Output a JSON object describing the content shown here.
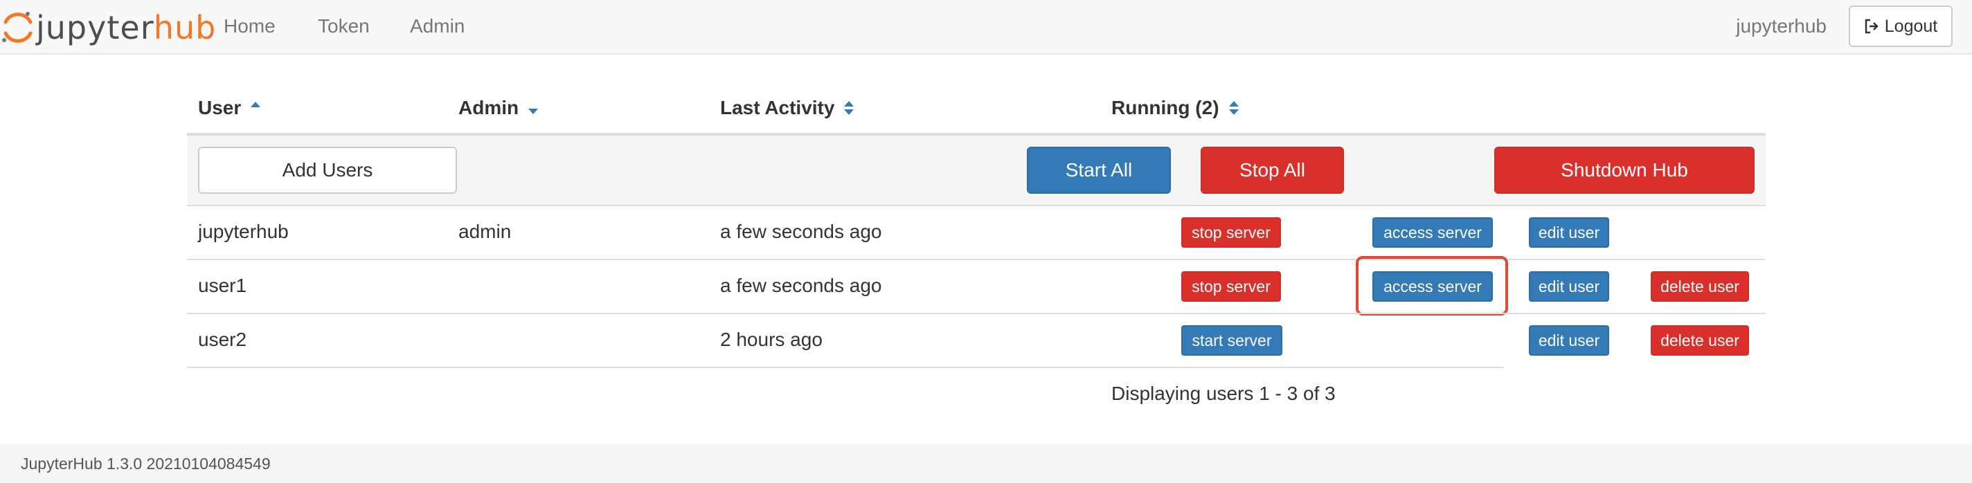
{
  "brand": {
    "prefix": "jupyter",
    "suffix": "hub"
  },
  "nav": {
    "links": [
      "Home",
      "Token",
      "Admin"
    ],
    "user": "jupyterhub",
    "logout_label": "Logout"
  },
  "table": {
    "headers": {
      "user": "User",
      "admin": "Admin",
      "last_activity": "Last Activity",
      "running": "Running (2)"
    },
    "actions": {
      "add_users": "Add Users",
      "start_all": "Start All",
      "stop_all": "Stop All",
      "shutdown_hub": "Shutdown Hub"
    },
    "rows": [
      {
        "name": "jupyterhub",
        "admin": "admin",
        "last_activity": "a few seconds ago",
        "server_btn": "stop server",
        "access": "access server",
        "edit": "edit user",
        "delete": ""
      },
      {
        "name": "user1",
        "admin": "",
        "last_activity": "a few seconds ago",
        "server_btn": "stop server",
        "access": "access server",
        "edit": "edit user",
        "delete": "delete user"
      },
      {
        "name": "user2",
        "admin": "",
        "last_activity": "2 hours ago",
        "server_btn": "start server",
        "access": "",
        "edit": "edit user",
        "delete": "delete user"
      }
    ],
    "pager": "Displaying users 1 - 3 of 3"
  },
  "footer": {
    "version": "JupyterHub 1.3.0 20210104084549"
  },
  "colors": {
    "primary": "#337ab7",
    "danger": "#d9302c",
    "brand_orange": "#f37726",
    "highlight": "#e04a35"
  }
}
